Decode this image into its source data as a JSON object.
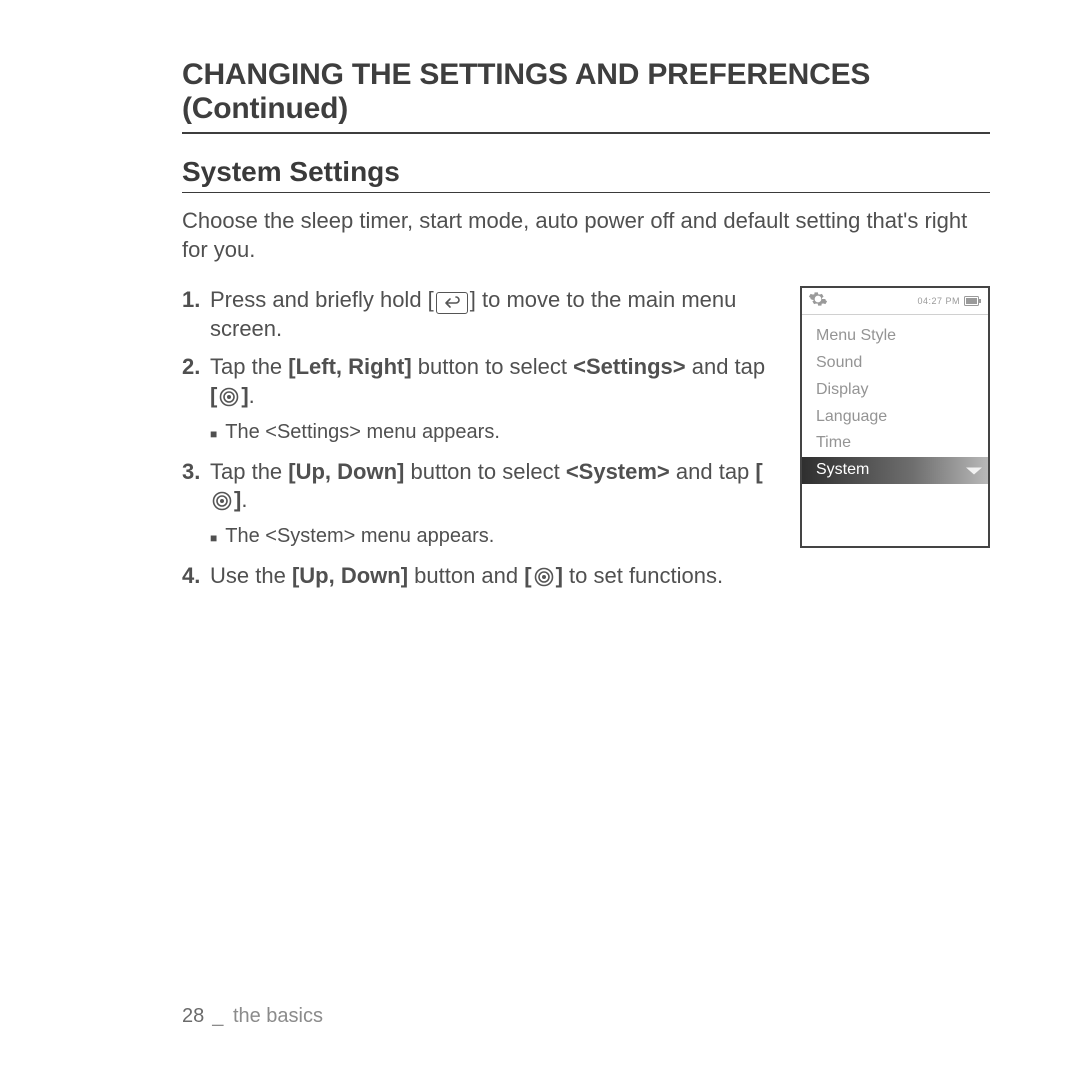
{
  "heading": "CHANGING THE SETTINGS AND PREFERENCES (Continued)",
  "subheading": "System Settings",
  "intro": "Choose the sleep timer, start mode, auto power off and default setting that's right for you.",
  "steps": {
    "s1": {
      "num": "1.",
      "a": "Press and briefly hold [",
      "b": "] to move to the main menu screen."
    },
    "s2": {
      "num": "2.",
      "a": "Tap the ",
      "b": "[Left, Right]",
      "c": " button to select ",
      "d": "<Settings>",
      "e": " and tap ",
      "f": "[",
      "g": "]",
      "h": ".",
      "sub": "The <Settings> menu appears."
    },
    "s3": {
      "num": "3.",
      "a": "Tap the ",
      "b": "[Up, Down]",
      "c": " button to select ",
      "d": "<System>",
      "e": " and tap ",
      "f": "[",
      "g": "]",
      "h": ".",
      "sub": "The <System> menu appears."
    },
    "s4": {
      "num": "4.",
      "a": "Use the ",
      "b": "[Up, Down]",
      "c": " button and ",
      "d": "[",
      "e": "]",
      "f": " to set functions."
    }
  },
  "device": {
    "time": "04:27 PM",
    "items": {
      "i0": "Menu Style",
      "i1": "Sound",
      "i2": "Display",
      "i3": "Language",
      "i4": "Time",
      "i5": "System"
    }
  },
  "footer": {
    "page": "28",
    "sep": "_",
    "section": "the basics"
  }
}
